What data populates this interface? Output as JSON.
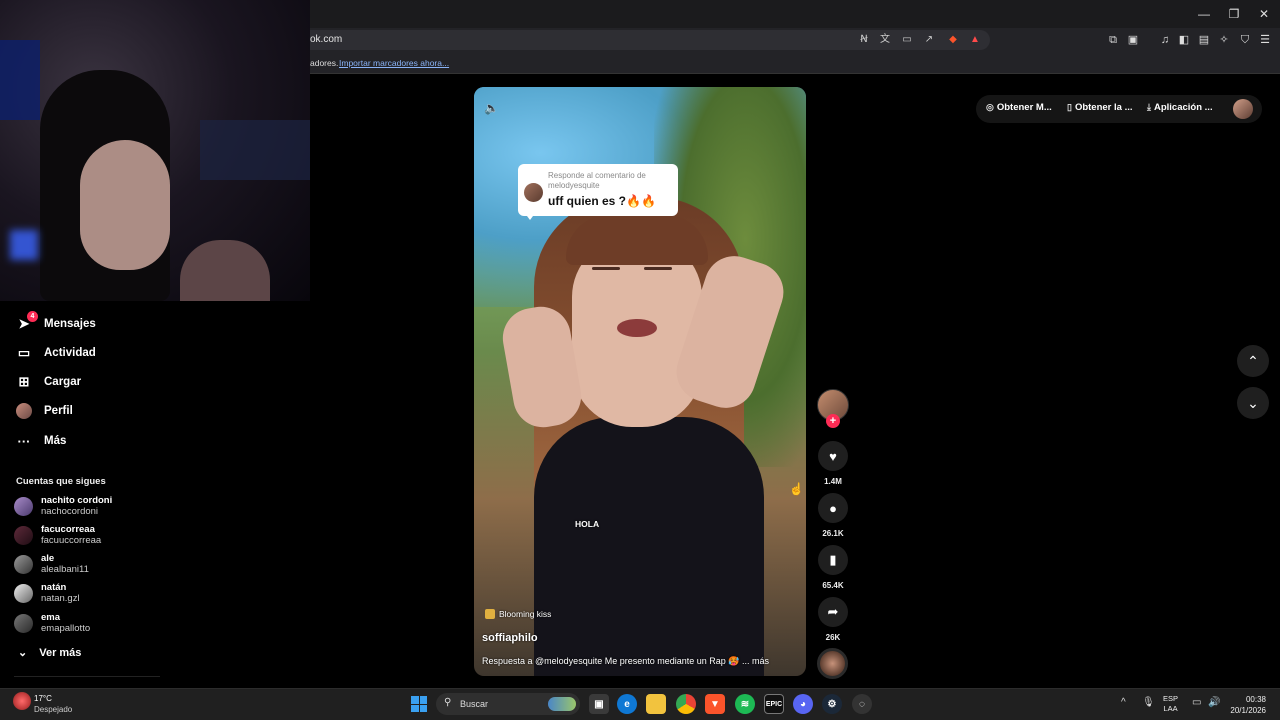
{
  "browser": {
    "url": "ok.com",
    "bookmarks_prefix": "adores.",
    "bookmarks_link": "Importar marcadores ahora...",
    "window_controls": [
      "—",
      "❐",
      "✕"
    ]
  },
  "sidebar": {
    "nav": [
      {
        "label": "Mensajes",
        "icon": "send-icon",
        "badge": "4"
      },
      {
        "label": "Actividad",
        "icon": "inbox-icon"
      },
      {
        "label": "Cargar",
        "icon": "upload-icon"
      },
      {
        "label": "Perfil",
        "icon": "avatar"
      },
      {
        "label": "Más",
        "icon": "more-icon"
      }
    ],
    "following_title": "Cuentas que sigues",
    "following": [
      {
        "name": "nachito cordoni",
        "user": "nachocordoni"
      },
      {
        "name": "facucorreaa",
        "user": "facuuccorreaa"
      },
      {
        "name": "ale",
        "user": "alealbani11"
      },
      {
        "name": "natán",
        "user": "natan.gzl"
      },
      {
        "name": "ema",
        "user": "emapallotto"
      }
    ],
    "see_more": "Ver más"
  },
  "video": {
    "reply_meta": "Responde al comentario de melodyesquite",
    "reply_text": "uff quien es ?🔥🔥",
    "overlay_text": "HOLA",
    "music": "Blooming kiss",
    "author": "soffiaphilo",
    "caption": "Respuesta a @melodyesquite Me presento mediante un Rap 🥵 ... más"
  },
  "actions": {
    "likes": "1.4M",
    "comments": "26.1K",
    "saves": "65.4K",
    "shares": "26K"
  },
  "top_right": {
    "item1": "Obtener M...",
    "item2": "Obtener la ...",
    "item3": "Aplicación ..."
  },
  "taskbar": {
    "temp": "17°C",
    "condition": "Despejado",
    "search": "Buscar",
    "lang1": "ESP",
    "lang2": "LAA",
    "time": "00:38",
    "date": "20/1/2026"
  },
  "colors": {
    "accent": "#fe2c55",
    "background": "#000000",
    "chrome": "#232327"
  }
}
